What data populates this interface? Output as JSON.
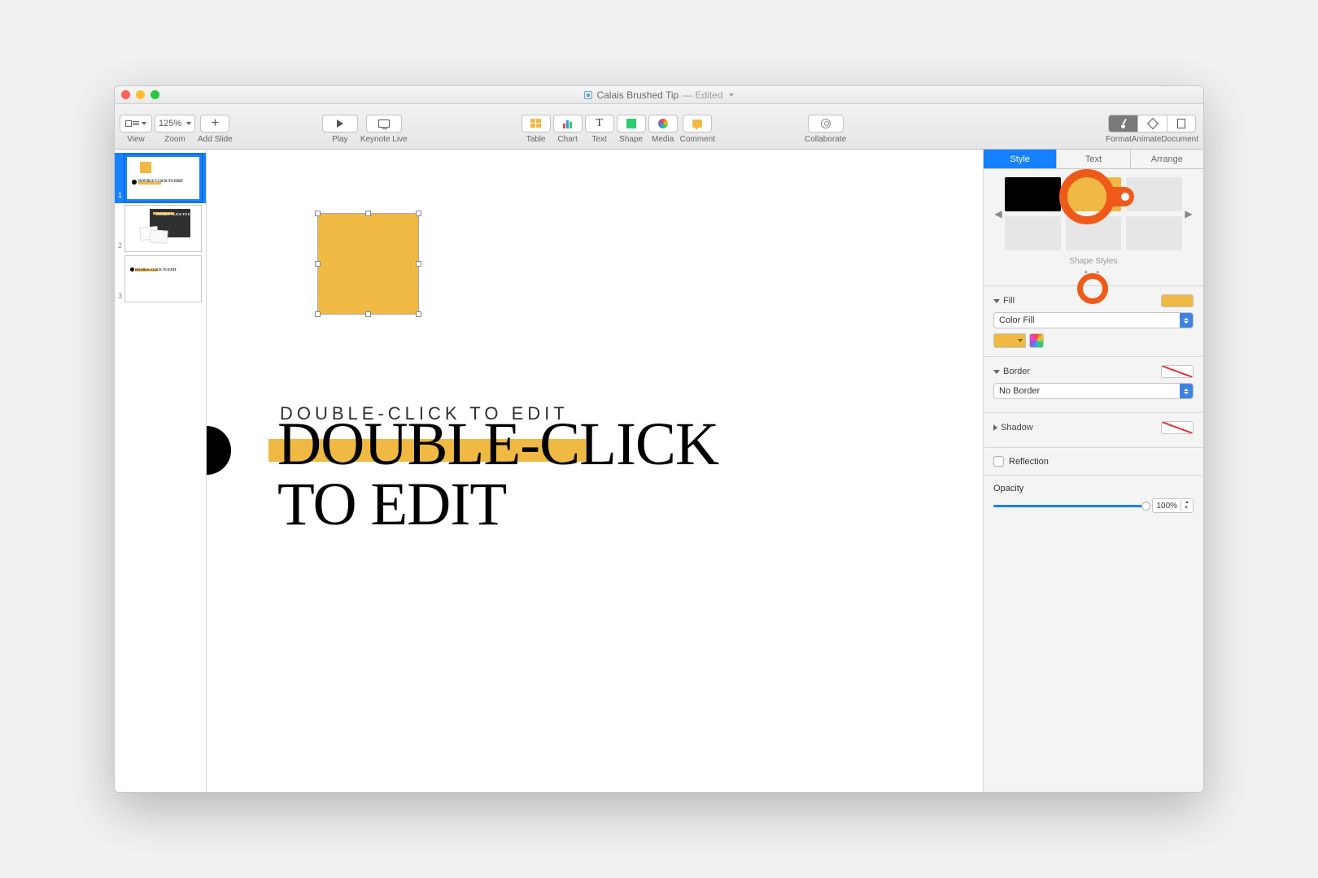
{
  "window": {
    "title": "Calais Brushed Tip",
    "edited_label": "— Edited"
  },
  "toolbar": {
    "view": "View",
    "zoom_value": "125%",
    "zoom": "Zoom",
    "add_slide": "Add Slide",
    "play": "Play",
    "keynote_live": "Keynote Live",
    "table": "Table",
    "chart": "Chart",
    "text": "Text",
    "shape": "Shape",
    "media": "Media",
    "comment": "Comment",
    "collaborate": "Collaborate",
    "format": "Format",
    "animate": "Animate",
    "document": "Document"
  },
  "slides": {
    "thumb1_text": "DOUBLE-CLICK\nTO EDIT",
    "thumb2_text": "DOUBLE-CLICK\nTO EDIT",
    "thumb3_text": "DOUBLE-CLICK TO EDIT",
    "num1": "1",
    "num2": "2",
    "num3": "3"
  },
  "canvas": {
    "subtitle": "DOUBLE-CLICK TO EDIT",
    "title": "DOUBLE-CLICK\nTO EDIT"
  },
  "inspector": {
    "tabs": {
      "style": "Style",
      "text": "Text",
      "arrange": "Arrange"
    },
    "shape_styles_label": "Shape Styles",
    "fill": {
      "label": "Fill",
      "type": "Color Fill",
      "color": "#f0b943"
    },
    "border": {
      "label": "Border",
      "type": "No Border"
    },
    "shadow": {
      "label": "Shadow"
    },
    "reflection": {
      "label": "Reflection"
    },
    "opacity": {
      "label": "Opacity",
      "value": "100%"
    }
  }
}
